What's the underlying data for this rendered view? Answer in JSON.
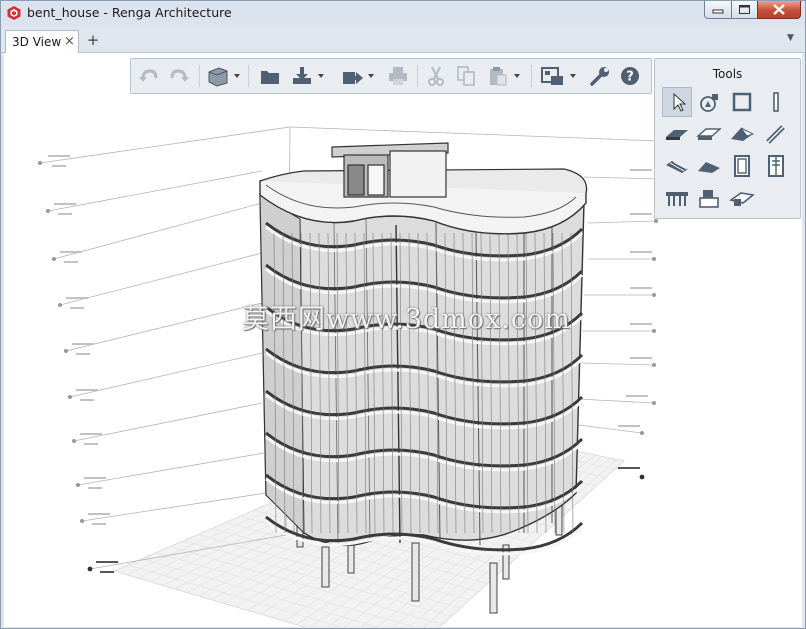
{
  "window": {
    "title": "bent_house - Renga Architecture",
    "app_icon": "renga-logo-icon",
    "buttons": [
      "minimize-icon",
      "maximize-icon",
      "close-icon"
    ]
  },
  "tabs": [
    {
      "label": "3D View",
      "close": "×",
      "active": true
    }
  ],
  "tab_add": "+",
  "tab_menu": "▼",
  "toolbar": {
    "items": [
      "undo-icon",
      "redo-icon",
      "view-cube-icon",
      "open-folder-icon",
      "import-icon",
      "export-icon",
      "print-icon",
      "cut-icon",
      "copy-icon",
      "paste-icon",
      "drawing-sheet-icon",
      "settings-wrench-icon",
      "help-icon"
    ]
  },
  "tools": {
    "title": "Tools",
    "items": [
      "select-arrow-icon",
      "shapes-icon",
      "wall-frame-icon",
      "column-icon",
      "slab-icon",
      "floor-icon",
      "roof-icon",
      "beam-icon",
      "stair-icon",
      "ramp-icon",
      "window-icon",
      "door-icon",
      "railing-icon",
      "equipment-icon",
      "opening-icon"
    ]
  },
  "viewport": {
    "watermark": "莫西网www.3dmox.com"
  },
  "colors": {
    "title_bar": "#dbe4ee",
    "close_button": "#c64f3a",
    "panel": "#e9edf1",
    "grid": "#e3e3e3"
  }
}
